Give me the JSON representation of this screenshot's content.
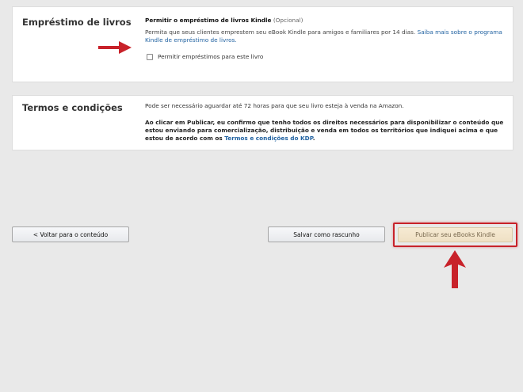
{
  "lending": {
    "section_title": "Empréstimo de livros",
    "option_title": "Permitir o empréstimo de livros Kindle",
    "option_optional": "(Opcional)",
    "description_text": "Permita que seus clientes emprestem seu eBook Kindle para amigos e familiares por 14 dias.",
    "description_link": "Saiba mais sobre o programa Kindle de empréstimo de livros.",
    "checkbox_label": "Permitir empréstimos para este livro",
    "checkbox_checked": false
  },
  "terms": {
    "section_title": "Termos e condições",
    "wait_text": "Pode ser necessário aguardar até 72 horas para que seu livro esteja à venda na Amazon.",
    "agreement_text": "Ao clicar em Publicar, eu confirmo que tenho todos os direitos necessários para disponibilizar o conteúdo que estou enviando para comercialização, distribuição e venda em todos os territórios que indiquei acima e que estou de acordo com os",
    "agreement_link": "Termos e condições do KDP",
    "agreement_end": "."
  },
  "buttons": {
    "back_label": "< Voltar para o conteúdo",
    "draft_label": "Salvar como rascunho",
    "publish_label": "Publicar seu eBooks Kindle"
  },
  "colors": {
    "annotation_red": "#c8222a",
    "link_blue": "#2162a1",
    "page_background": "#e9e9e9"
  }
}
